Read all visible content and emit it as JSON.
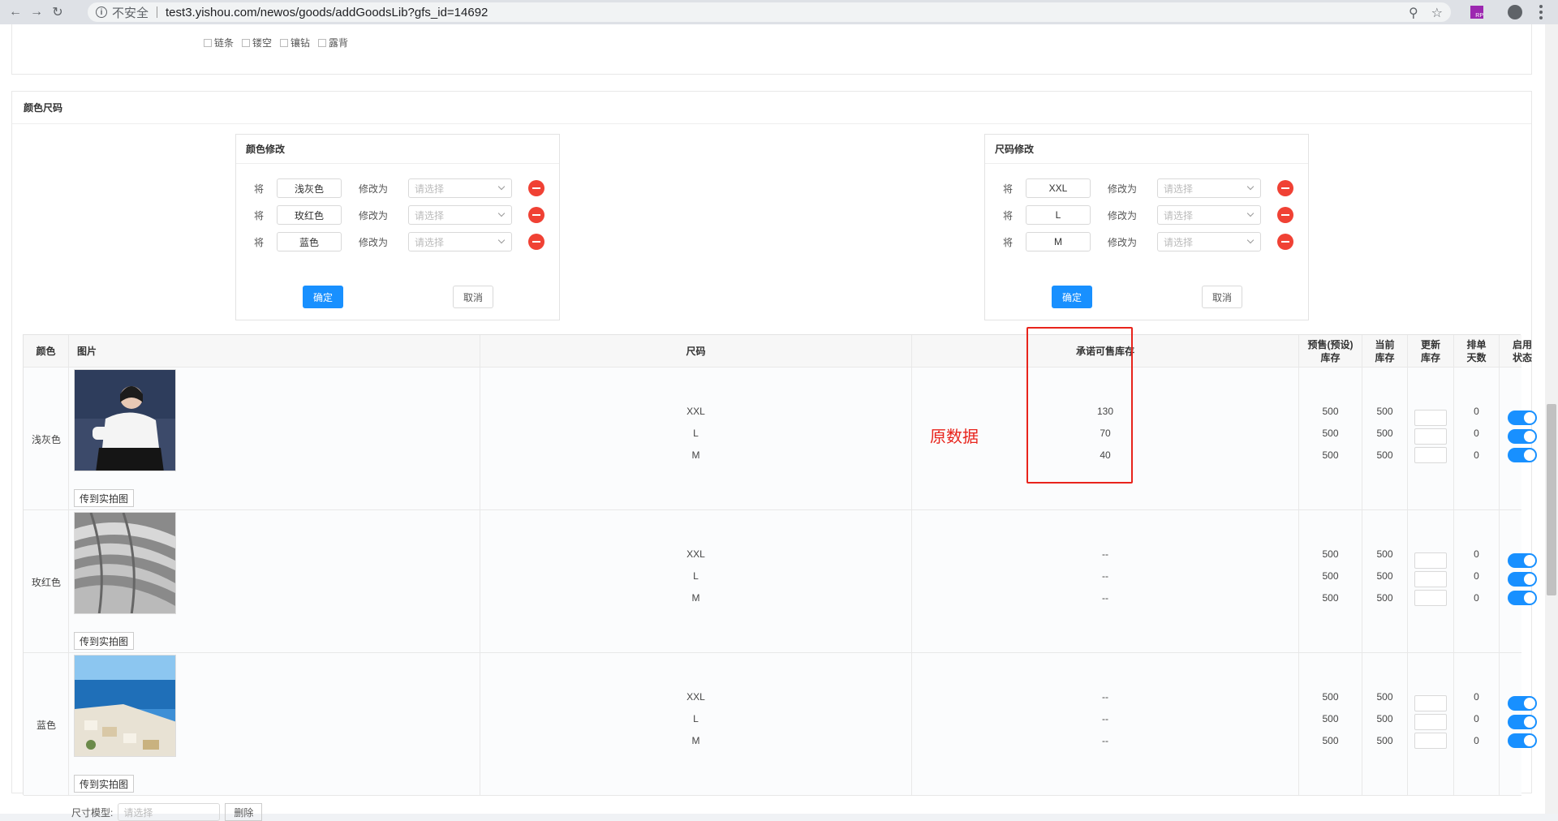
{
  "browser": {
    "insecure_label": "不安全",
    "url": "test3.yishou.com/newos/goods/addGoodsLib?gfs_id=14692",
    "ext_label": "RP"
  },
  "top_checks": [
    "链条",
    "镂空",
    "镶钻",
    "露背"
  ],
  "section": {
    "title": "颜色尺码"
  },
  "color_edit": {
    "title": "颜色修改",
    "jiang_label": "将",
    "to_label": "修改为",
    "placeholder": "请选择",
    "rows": [
      "浅灰色",
      "玫红色",
      "蓝色"
    ],
    "confirm": "确定",
    "cancel": "取消"
  },
  "size_edit": {
    "title": "尺码修改",
    "jiang_label": "将",
    "to_label": "修改为",
    "placeholder": "请选择",
    "rows": [
      "XXL",
      "L",
      "M"
    ],
    "confirm": "确定",
    "cancel": "取消"
  },
  "table": {
    "headers": {
      "color": "颜色",
      "image": "图片",
      "size": "尺码",
      "promised_stock": "承诺可售库存",
      "presale_stock": "预售(预设)库存",
      "current_stock": "当前库存",
      "update_stock": "更新库存",
      "schedule_days": "排单天数",
      "status": "启用状态"
    },
    "upload_label": "传到实拍图",
    "rows": [
      {
        "color": "浅灰色",
        "sizes": [
          "XXL",
          "L",
          "M"
        ],
        "promised": [
          "130",
          "70",
          "40"
        ],
        "presale": [
          "500",
          "500",
          "500"
        ],
        "current": [
          "500",
          "500",
          "500"
        ],
        "days": [
          "0",
          "0",
          "0"
        ],
        "enabled": [
          true,
          true,
          true
        ]
      },
      {
        "color": "玫红色",
        "sizes": [
          "XXL",
          "L",
          "M"
        ],
        "promised": [
          "--",
          "--",
          "--"
        ],
        "presale": [
          "500",
          "500",
          "500"
        ],
        "current": [
          "500",
          "500",
          "500"
        ],
        "days": [
          "0",
          "0",
          "0"
        ],
        "enabled": [
          true,
          true,
          true
        ]
      },
      {
        "color": "蓝色",
        "sizes": [
          "XXL",
          "L",
          "M"
        ],
        "promised": [
          "--",
          "--",
          "--"
        ],
        "presale": [
          "500",
          "500",
          "500"
        ],
        "current": [
          "500",
          "500",
          "500"
        ],
        "days": [
          "0",
          "0",
          "0"
        ],
        "enabled": [
          true,
          true,
          true
        ]
      }
    ]
  },
  "annotation": "原数据",
  "bottom": {
    "label": "尺寸模型:",
    "placeholder": "请选择",
    "delete": "删除"
  },
  "colors": {
    "accent": "#1890ff",
    "danger": "#f04134",
    "annotation": "#e8241c"
  }
}
